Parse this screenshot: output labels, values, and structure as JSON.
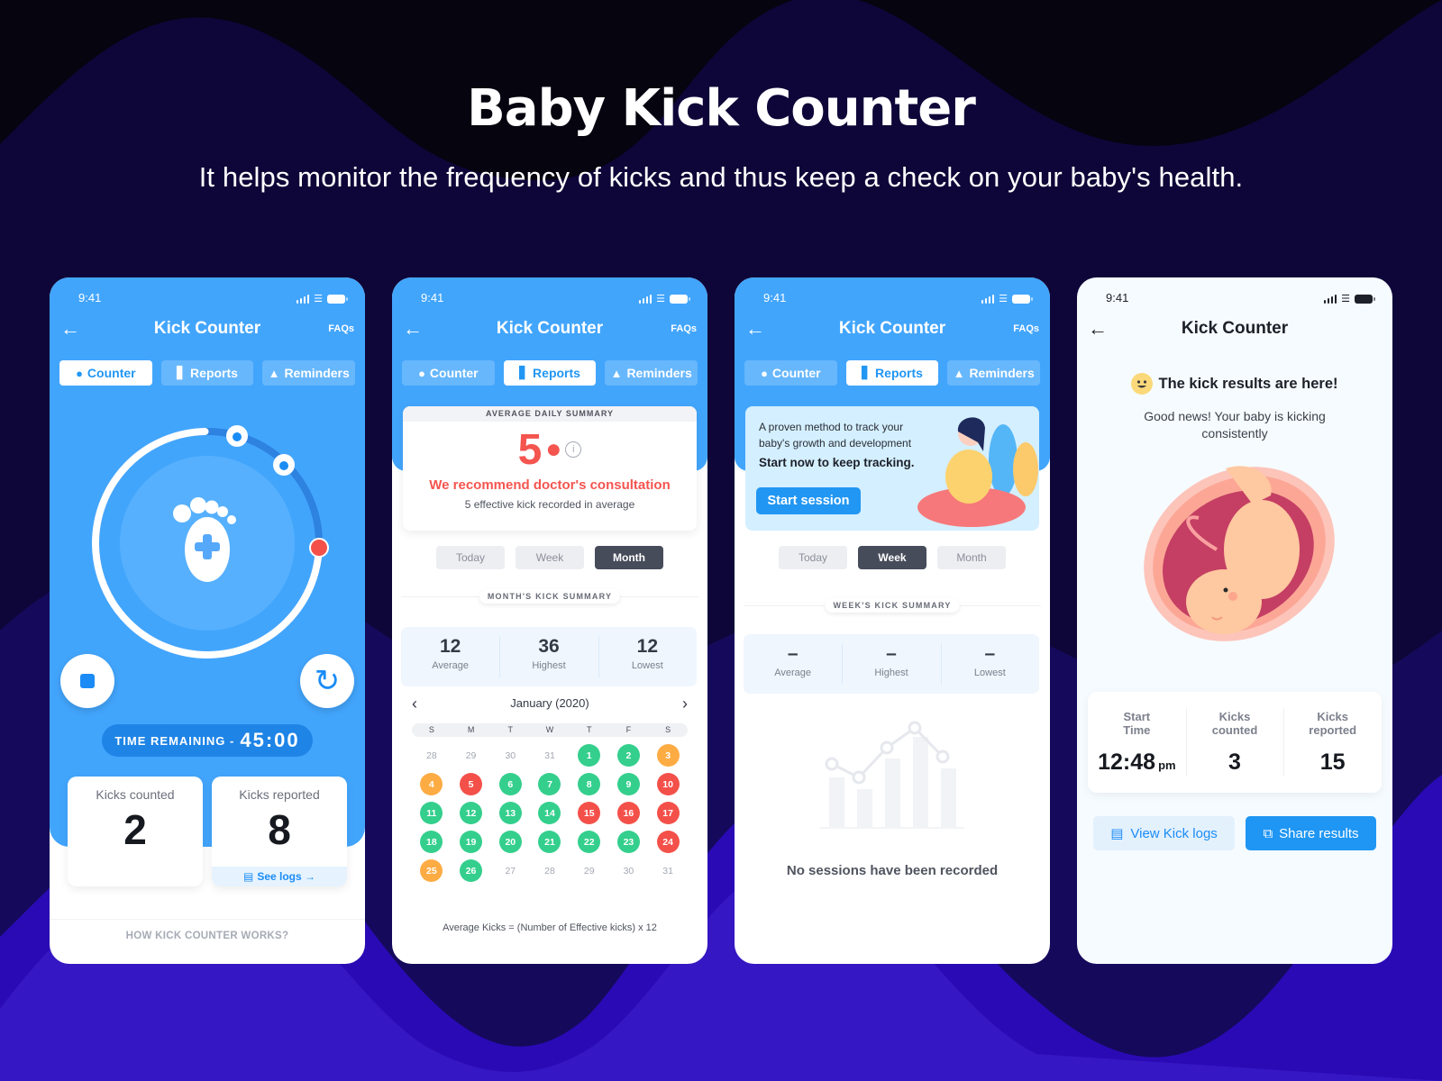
{
  "hero": {
    "title": "Baby Kick Counter",
    "subtitle": "It helps monitor the frequency of kicks and thus keep a check on your baby's health."
  },
  "colors": {
    "brand_blue": "#42a5fc",
    "accent_blue": "#1b8cf6",
    "alert_red": "#f4554f",
    "good_green": "#34cf8d",
    "warn_orange": "#fdac44",
    "dark_segment": "#474c5b"
  },
  "common": {
    "status_time": "9:41",
    "app_title": "Kick Counter",
    "faq_label": "FAQs",
    "back_icon": "arrow-left-icon",
    "tabs": [
      {
        "label": "Counter",
        "icon": "footprint-icon"
      },
      {
        "label": "Reports",
        "icon": "bar-chart-icon"
      },
      {
        "label": "Reminders",
        "icon": "bell-icon"
      }
    ]
  },
  "counter_screen": {
    "active_tab": "Counter",
    "progress_fraction": 0.25,
    "time_remaining_label": "TIME REMAINING -",
    "time_remaining_value": "45:00",
    "kicks_counted_label": "Kicks counted",
    "kicks_counted_value": "2",
    "kicks_reported_label": "Kicks reported",
    "kicks_reported_value": "8",
    "see_logs_label": "See logs →",
    "how_it_works": "HOW KICK COUNTER WORKS?"
  },
  "month_report": {
    "active_tab": "Reports",
    "summary_header": "AVERAGE DAILY SUMMARY",
    "average_value": "5",
    "info_glyph": "i",
    "warning": "We recommend doctor's consultation",
    "subtext": "5 effective kick recorded in average",
    "segments": [
      "Today",
      "Week",
      "Month"
    ],
    "active_segment": "Month",
    "section_label": "MONTH'S KICK SUMMARY",
    "stats": [
      {
        "value": "12",
        "label": "Average"
      },
      {
        "value": "36",
        "label": "Highest"
      },
      {
        "value": "12",
        "label": "Lowest"
      }
    ],
    "calendar": {
      "month_label": "January (2020)",
      "prev": "‹",
      "next": "›",
      "weekdays": [
        "S",
        "M",
        "T",
        "W",
        "T",
        "F",
        "S"
      ],
      "days": [
        {
          "d": "28",
          "s": "muted"
        },
        {
          "d": "29",
          "s": "muted"
        },
        {
          "d": "30",
          "s": "muted"
        },
        {
          "d": "31",
          "s": "muted"
        },
        {
          "d": "1",
          "s": "good"
        },
        {
          "d": "2",
          "s": "good"
        },
        {
          "d": "3",
          "s": "warn"
        },
        {
          "d": "4",
          "s": "warn"
        },
        {
          "d": "5",
          "s": "bad"
        },
        {
          "d": "6",
          "s": "good"
        },
        {
          "d": "7",
          "s": "good"
        },
        {
          "d": "8",
          "s": "good"
        },
        {
          "d": "9",
          "s": "good"
        },
        {
          "d": "10",
          "s": "bad"
        },
        {
          "d": "11",
          "s": "good"
        },
        {
          "d": "12",
          "s": "good"
        },
        {
          "d": "13",
          "s": "good"
        },
        {
          "d": "14",
          "s": "good"
        },
        {
          "d": "15",
          "s": "bad"
        },
        {
          "d": "16",
          "s": "bad"
        },
        {
          "d": "17",
          "s": "bad"
        },
        {
          "d": "18",
          "s": "good"
        },
        {
          "d": "19",
          "s": "good"
        },
        {
          "d": "20",
          "s": "good"
        },
        {
          "d": "21",
          "s": "good"
        },
        {
          "d": "22",
          "s": "good"
        },
        {
          "d": "23",
          "s": "good"
        },
        {
          "d": "24",
          "s": "bad"
        },
        {
          "d": "25",
          "s": "warn"
        },
        {
          "d": "26",
          "s": "good"
        },
        {
          "d": "27",
          "s": "muted"
        },
        {
          "d": "28",
          "s": "muted"
        },
        {
          "d": "29",
          "s": "muted"
        },
        {
          "d": "30",
          "s": "muted"
        },
        {
          "d": "31",
          "s": "muted"
        }
      ]
    },
    "formula": "Average Kicks = (Number of Effective kicks) x 12"
  },
  "week_report": {
    "active_tab": "Reports",
    "promo_text": "A proven method to track your baby's growth and development",
    "promo_cta_text": "Start now to keep tracking.",
    "start_session_label": "Start session",
    "segments": [
      "Today",
      "Week",
      "Month"
    ],
    "active_segment": "Week",
    "section_label": "WEEK'S KICK SUMMARY",
    "stats": [
      {
        "value": "–",
        "label": "Average"
      },
      {
        "value": "–",
        "label": "Highest"
      },
      {
        "value": "–",
        "label": "Lowest"
      }
    ],
    "empty_message": "No sessions have been recorded"
  },
  "results_screen": {
    "headline": "The kick results are here!",
    "message": "Good news! Your baby is kicking consistently",
    "start_time_label": "Start Time",
    "start_time_value": "12:48",
    "start_time_suffix": "pm",
    "kicks_counted_label": "Kicks counted",
    "kicks_counted_value": "3",
    "kicks_reported_label": "Kicks reported",
    "kicks_reported_value": "15",
    "view_logs_label": "View Kick logs",
    "share_label": "Share results"
  }
}
